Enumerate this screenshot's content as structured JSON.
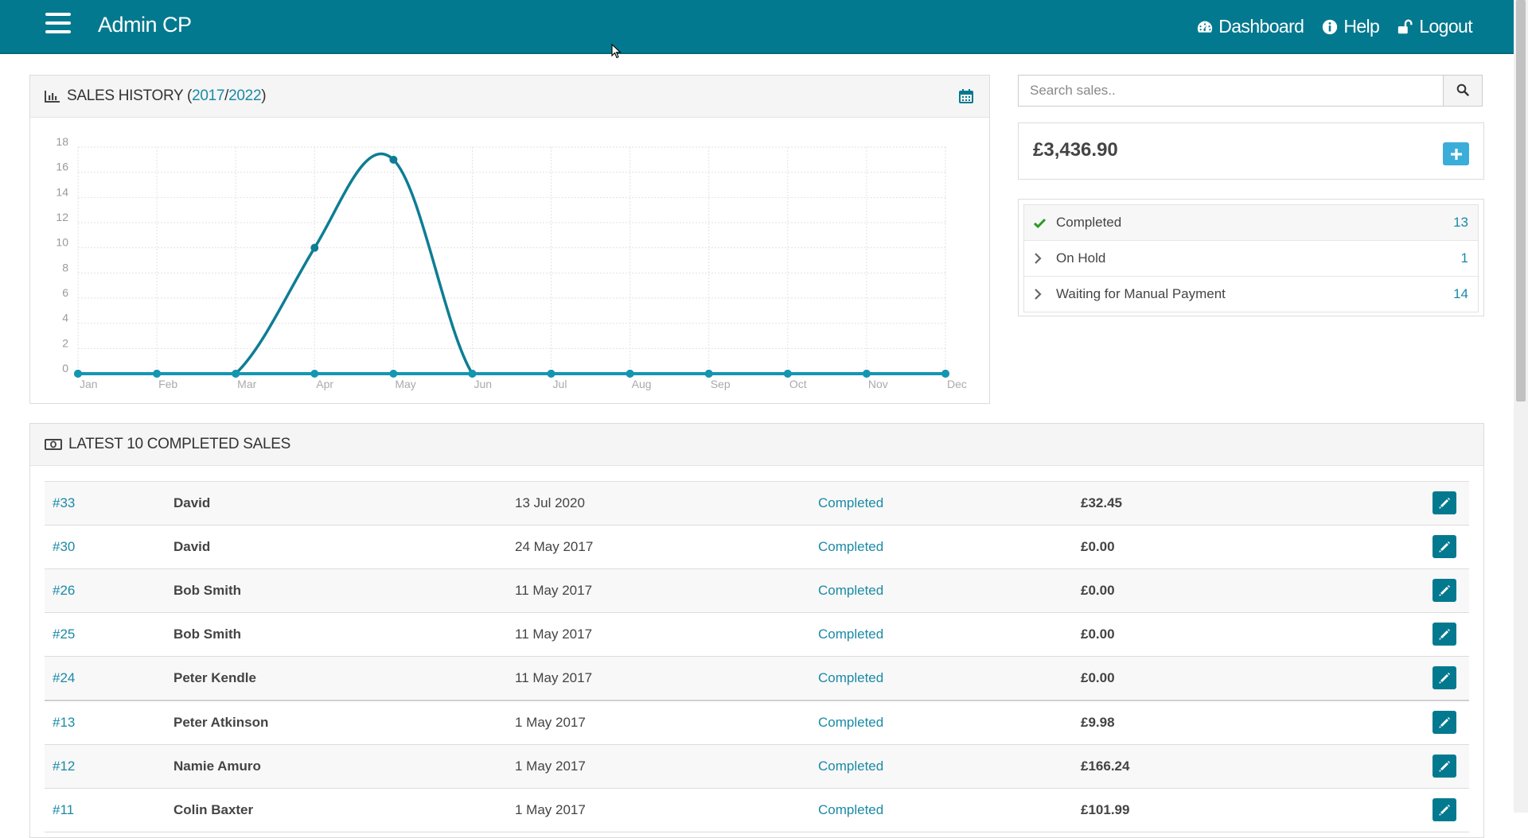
{
  "header": {
    "brand": "Admin CP",
    "nav": [
      {
        "label": "Dashboard",
        "icon": "dashboard-icon"
      },
      {
        "label": "Help",
        "icon": "info-icon"
      },
      {
        "label": "Logout",
        "icon": "unlock-icon"
      }
    ]
  },
  "sales_history": {
    "title_prefix": "SALES HISTORY (",
    "year_a": "2017",
    "separator": " / ",
    "year_b": "2022",
    "title_suffix": ")"
  },
  "search": {
    "placeholder": "Search sales.."
  },
  "summary": {
    "total": "£3,436.90"
  },
  "statuses": [
    {
      "label": "Completed",
      "count": "13",
      "icon": "check-icon"
    },
    {
      "label": "On Hold",
      "count": "1",
      "icon": "chevron-right-icon"
    },
    {
      "label": "Waiting for Manual Payment",
      "count": "14",
      "icon": "chevron-right-icon"
    }
  ],
  "latest": {
    "title": "LATEST 10 COMPLETED SALES",
    "rows": [
      {
        "id": "#33",
        "name": "David",
        "date": "13 Jul 2020",
        "status": "Completed",
        "amount": "£32.45"
      },
      {
        "id": "#30",
        "name": "David",
        "date": "24 May 2017",
        "status": "Completed",
        "amount": "£0.00"
      },
      {
        "id": "#26",
        "name": "Bob Smith",
        "date": "11 May 2017",
        "status": "Completed",
        "amount": "£0.00"
      },
      {
        "id": "#25",
        "name": "Bob Smith",
        "date": "11 May 2017",
        "status": "Completed",
        "amount": "£0.00"
      },
      {
        "id": "#24",
        "name": "Peter Kendle",
        "date": "11 May 2017",
        "status": "Completed",
        "amount": "£0.00"
      },
      {
        "id": "#13",
        "name": "Peter Atkinson",
        "date": "1 May 2017",
        "status": "Completed",
        "amount": "£9.98"
      },
      {
        "id": "#12",
        "name": "Namie Amuro",
        "date": "1 May 2017",
        "status": "Completed",
        "amount": "£166.24"
      },
      {
        "id": "#11",
        "name": "Colin Baxter",
        "date": "1 May 2017",
        "status": "Completed",
        "amount": "£101.99"
      }
    ]
  },
  "colors": {
    "primary": "#03798f",
    "link": "#1a8aa6",
    "series_a": "#0e7d94",
    "series_b": "#1496b1",
    "add_button": "#3aaed8"
  },
  "chart_data": {
    "type": "line",
    "categories": [
      "Jan",
      "Feb",
      "Mar",
      "Apr",
      "May",
      "Jun",
      "Jul",
      "Aug",
      "Sep",
      "Oct",
      "Nov",
      "Dec"
    ],
    "series": [
      {
        "values": [
          0,
          0,
          0,
          10,
          17,
          0,
          0,
          0,
          0,
          0,
          0,
          0
        ]
      },
      {
        "values": [
          0,
          0,
          0,
          0,
          0,
          0,
          0,
          0,
          0,
          0,
          0,
          0
        ]
      }
    ],
    "ylim": [
      0,
      18
    ],
    "yticks": [
      0,
      2,
      4,
      6,
      8,
      10,
      12,
      14,
      16,
      18
    ],
    "grid": true,
    "smooth": true
  }
}
